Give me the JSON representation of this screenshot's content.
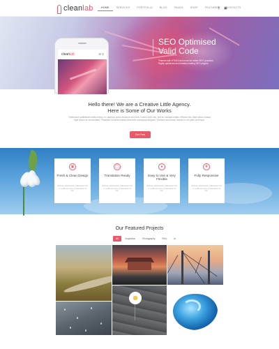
{
  "brand": {
    "part1": "clean",
    "part2": "lab"
  },
  "nav": [
    "Home",
    "Services",
    "Portfolio",
    "Blog",
    "Pages",
    "Shop",
    "Features",
    "Contacts"
  ],
  "hero": {
    "title_line1": "SEO Optimised",
    "title_line2": "Valid Code",
    "description": "Themes with HTML5 and more for better SEO practices. Highly optimized and industry leading SEO plugins."
  },
  "phone": {
    "brand_part1": "clean",
    "brand_part2": "lab"
  },
  "intro": {
    "title_line1": "Hello there! We are a Creative Little Agency.",
    "title_line2": "Here is Some of Our Works",
    "text": "Vestibulum sollicitudin mollis lectus, eu dapibus purus tincidunt sed nibh. Donec enim nisl, sed eu volutpat mattis, efficitur nisl. Nam dolor, massa eget ipsum ac consectetur. Phasellus sit amet massa vitae felis consequat aliquam. Vivamus accumsan lacinia ex vel justo ut tempor.",
    "button": "Get Free"
  },
  "features": [
    {
      "icon": "monitor-icon",
      "title": "Fresh & Clean Design",
      "text": "Aenean ullamcorper sollicitudin nisl ut mollis vel nunc consectetur ac nisi."
    },
    {
      "icon": "translate-icon",
      "title": "Translation Ready",
      "text": "Aenean ullamcorper sollicitudin nisl ut mollis vel nunc consectetur ac nisi."
    },
    {
      "icon": "bulb-icon",
      "title": "Easy to Use & Very Flexible",
      "text": "Aenean ullamcorper sollicitudin nisl ut mollis vel nunc consectetur ac nisi."
    },
    {
      "icon": "lifebuoy-icon",
      "title": "Fully Responsive",
      "text": "Aenean ullamcorper sollicitudin nisl ut mollis vel nunc consectetur ac nisi."
    }
  ],
  "projects": {
    "title": "Our Featured Projects",
    "filters": [
      "All",
      "Inspiration",
      "Photography",
      "Print",
      "UI"
    ],
    "active_filter": "All"
  },
  "colors": {
    "accent": "#e85a6a",
    "sky_top": "#2f7fc4",
    "sky_bottom": "#9fcdef"
  }
}
